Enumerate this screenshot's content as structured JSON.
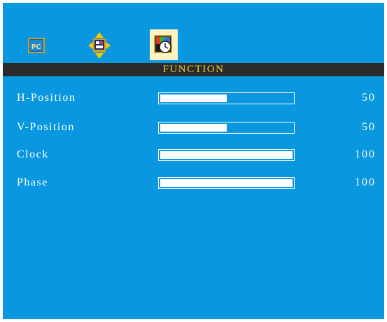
{
  "menu": {
    "icons": [
      {
        "name": "pc-image-icon",
        "label": "PC",
        "selected": false
      },
      {
        "name": "display-position-icon",
        "selected": false
      },
      {
        "name": "function-clock-icon",
        "selected": true
      }
    ],
    "title": "FUNCTION",
    "colors": {
      "background": "#0997df",
      "title_bar": "#2a2a2a",
      "title_text": "#f2cd34",
      "selected_icon_bg": "#fff3c4"
    }
  },
  "items": [
    {
      "label": "H-Position",
      "value": "50",
      "level": 0.5
    },
    {
      "label": "V-Position",
      "value": "50",
      "level": 0.5
    },
    {
      "label": "Clock",
      "value": "100",
      "level": 1.0
    },
    {
      "label": "Phase",
      "value": "100",
      "level": 1.0
    }
  ]
}
